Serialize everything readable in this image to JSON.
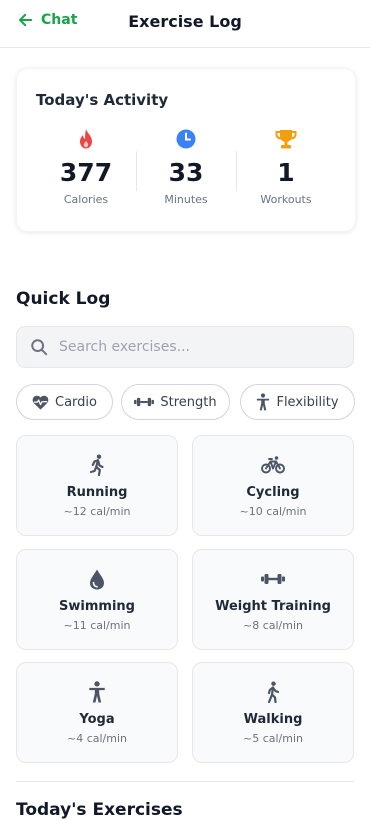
{
  "header": {
    "back_label": "Chat",
    "title": "Exercise Log"
  },
  "activity": {
    "title": "Today's Activity",
    "stats": [
      {
        "value": "377",
        "label": "Calories",
        "icon": "flame-icon",
        "color": "#ef4444"
      },
      {
        "value": "33",
        "label": "Minutes",
        "icon": "clock-icon",
        "color": "#3b82f6"
      },
      {
        "value": "1",
        "label": "Workouts",
        "icon": "trophy-icon",
        "color": "#f59e0b"
      }
    ]
  },
  "quick_log": {
    "title": "Quick Log",
    "search_placeholder": "Search exercises...",
    "filters": [
      {
        "label": "Cardio",
        "icon": "heartbeat-icon"
      },
      {
        "label": "Strength",
        "icon": "dumbbell-icon"
      },
      {
        "label": "Flexibility",
        "icon": "person-icon"
      }
    ],
    "exercises": [
      {
        "name": "Running",
        "cal": "~12 cal/min",
        "icon": "running-icon"
      },
      {
        "name": "Cycling",
        "cal": "~10 cal/min",
        "icon": "bicycle-icon"
      },
      {
        "name": "Swimming",
        "cal": "~11 cal/min",
        "icon": "water-drop-icon"
      },
      {
        "name": "Weight Training",
        "cal": "~8 cal/min",
        "icon": "dumbbell-icon"
      },
      {
        "name": "Yoga",
        "cal": "~4 cal/min",
        "icon": "person-icon"
      },
      {
        "name": "Walking",
        "cal": "~5 cal/min",
        "icon": "walking-icon"
      }
    ]
  },
  "colors": {
    "accent": "#16a34a",
    "icon_gray": "#4b5563"
  },
  "today_section_title": "Today's Exercises"
}
